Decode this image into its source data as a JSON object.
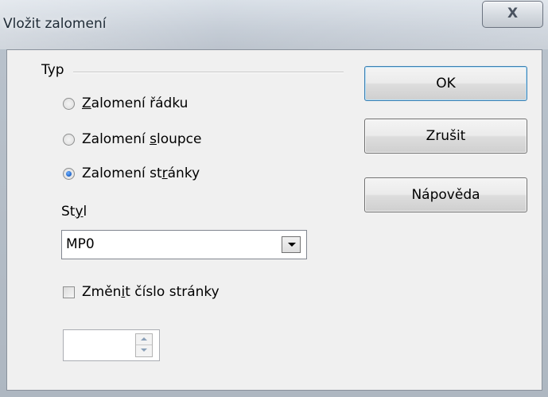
{
  "window": {
    "title": "Vložit zalomení",
    "close_glyph": "X"
  },
  "type_group": {
    "label": "Typ",
    "options": [
      {
        "pre": "",
        "key": "Z",
        "post": "alomení řádku",
        "checked": false
      },
      {
        "pre": "Zalomení ",
        "key": "s",
        "post": "loupce",
        "checked": false
      },
      {
        "pre": "Zalomení st",
        "key": "r",
        "post": "ánky",
        "checked": true
      }
    ]
  },
  "style": {
    "label_pre": "St",
    "label_key": "y",
    "label_post": "l",
    "selected": "MP0"
  },
  "change_page_number": {
    "label_pre": "Změn",
    "label_key": "i",
    "label_post": "t číslo stránky",
    "checked": false
  },
  "page_number": {
    "value": ""
  },
  "buttons": {
    "ok": "OK",
    "cancel": "Zrušit",
    "help": "Nápověda"
  }
}
